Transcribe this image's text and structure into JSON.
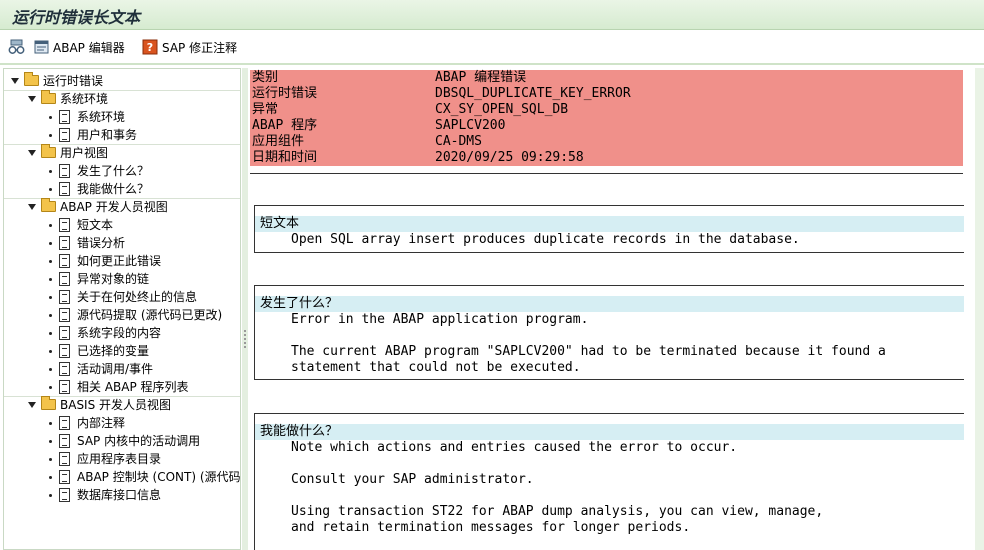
{
  "window": {
    "title": "运行时错误长文本"
  },
  "toolbar": {
    "abap_editor_label": "ABAP 编辑器",
    "sap_note_label": "SAP 修正注释"
  },
  "tree": {
    "root": "运行时错误",
    "system_env": {
      "label": "系统环境",
      "items": [
        "系统环境",
        "用户和事务"
      ]
    },
    "user_view": {
      "label": "用户视图",
      "items": [
        "发生了什么？",
        "我能做什么？"
      ]
    },
    "abap_dev_view": {
      "label": "ABAP 开发人员视图",
      "items": [
        "短文本",
        "错误分析",
        "如何更正此错误",
        "异常对象的链",
        "关于在何处终止的信息",
        "源代码提取 (源代码已更改)",
        "系统字段的内容",
        "已选择的变量",
        "活动调用/事件",
        "相关 ABAP 程序列表"
      ]
    },
    "basis_dev_view": {
      "label": "BASIS 开发人员视图",
      "items": [
        "内部注释",
        "SAP 内核中的活动调用",
        "应用程序表目录",
        "ABAP 控制块 (CONT) (源代码",
        "数据库接口信息"
      ]
    }
  },
  "error_info": {
    "rows": [
      {
        "key": "类别",
        "value": "ABAP 编程错误"
      },
      {
        "key": "运行时错误",
        "value": "DBSQL_DUPLICATE_KEY_ERROR"
      },
      {
        "key": "异常",
        "value": "CX_SY_OPEN_SQL_DB"
      },
      {
        "key": "ABAP 程序",
        "value": "SAPLCV200"
      },
      {
        "key": "应用组件",
        "value": "CA-DMS"
      },
      {
        "key": "日期和时间",
        "value": "2020/09/25 09:29:58"
      }
    ]
  },
  "sections": {
    "short_text": {
      "heading": "短文本",
      "lines": [
        "Open SQL array insert produces duplicate records in the database."
      ]
    },
    "what_happened": {
      "heading": "发生了什么？",
      "lines": [
        "Error in the ABAP application program.",
        "",
        "The current ABAP program \"SAPLCV200\" had to be terminated because it found a",
        "statement that could not be executed."
      ]
    },
    "what_can_i_do": {
      "heading": "我能做什么？",
      "lines": [
        "Note which actions and entries caused the error to occur.",
        "",
        "Consult your SAP administrator.",
        "",
        "Using transaction ST22 for ABAP dump analysis, you can view, manage,",
        "and retain termination messages for longer periods."
      ]
    }
  },
  "colors": {
    "info_background": "#f0908a",
    "section_heading_background": "#d6eef3",
    "titlebar_background": "#d6ebd0"
  }
}
